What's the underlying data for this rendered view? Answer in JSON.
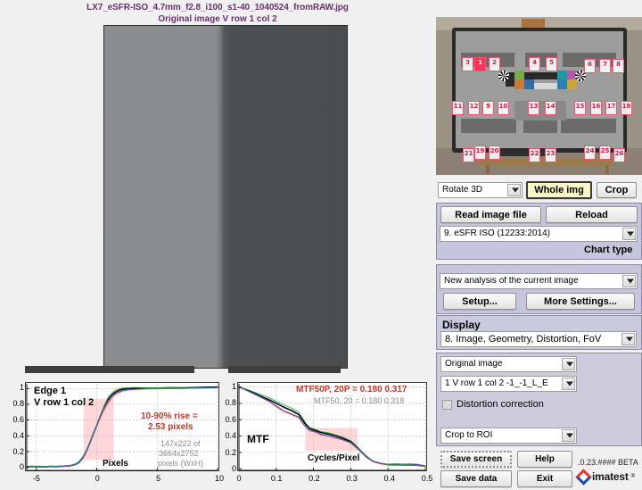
{
  "window": {
    "app": "Imatest",
    "version_text": ".0.23.#### BETA",
    "brand": "imatest",
    "brand_reg": "®"
  },
  "header": {
    "title_line1": "LX7_eSFR-ISO_4.7mm_f2.8_i100_s1-40_1040524_fromRAW.jpg",
    "title_line2": "Original image   V row 1 col 2",
    "title_color": "#6b2f6b"
  },
  "main_image": {
    "name": "edge-crop-preview",
    "description": "Original image V row 1 col 2 - vertical slanted edge crop",
    "left_luminance": "#8b8e90",
    "right_luminance": "#4a4d4f"
  },
  "thumbnail": {
    "name": "whole-image-thumbnail",
    "description": "eSFR ISO test chart on TV screen with 26 numbered edge ROIs",
    "roi_labels": [
      "1",
      "2",
      "3",
      "4",
      "5",
      "6",
      "7",
      "8",
      "9",
      "10",
      "11",
      "12",
      "13",
      "14",
      "15",
      "16",
      "17",
      "18",
      "19",
      "20",
      "21",
      "22",
      "23",
      "24",
      "25",
      "26"
    ],
    "selected_roi": "1",
    "roi_color": "#ff4d6d",
    "roi_selected_color": "#ff3355"
  },
  "controls": {
    "rotate_select": {
      "value": "Rotate 3D",
      "options": [
        "Rotate 3D"
      ]
    },
    "whole_img_button": "Whole img",
    "crop_button": "Crop",
    "read_image_file_button": "Read image file",
    "reload_button": "Reload",
    "chart_select": {
      "value": "9. eSFR ISO  (12233:2014)",
      "options": [
        "9. eSFR ISO  (12233:2014)"
      ]
    },
    "chart_type_label": "Chart type",
    "analysis_select": {
      "value": "New analysis of the current image",
      "options": [
        "New analysis of the current image"
      ]
    },
    "setup_button": "Setup...",
    "more_settings_button": "More Settings...",
    "display_label": "Display",
    "display_select": {
      "value": "8.   Image, Geometry, Distortion, FoV",
      "options": [
        "8.   Image, Geometry, Distortion, FoV"
      ]
    },
    "image_select": {
      "value": "Original image",
      "options": [
        "Original image"
      ]
    },
    "roi_select": {
      "value": "1  V row 1 col 2   -1_-1_L_E",
      "options": [
        "1  V row 1 col 2   -1_-1_L_E"
      ]
    },
    "distortion_correction": {
      "label": "Distortion correction",
      "checked": false
    },
    "crop_select": {
      "value": "Crop to ROI",
      "options": [
        "Crop to ROI"
      ]
    },
    "save_screen_button": "Save screen",
    "help_button": "Help",
    "save_data_button": "Save data",
    "exit_button": "Exit"
  },
  "chart_data": [
    {
      "type": "line",
      "name": "edge-profile-plot",
      "title": "Edge 1",
      "subtitle": "V row 1 col 2",
      "xlabel": "Pixels",
      "ylabel": "",
      "xlim": [
        -5.8,
        10
      ],
      "ylim": [
        -0.04,
        1.06
      ],
      "xticks": [
        -5,
        0,
        5,
        10
      ],
      "xticklabels": [
        "-5",
        "0",
        "5",
        "10"
      ],
      "yticks": [
        0,
        0.2,
        0.4,
        0.6,
        0.8,
        1
      ],
      "yticklabels": [
        "0",
        "0.2",
        "0.4",
        "0.6",
        "0.8",
        "1"
      ],
      "grid": true,
      "annotations": [
        {
          "text": "10-90% rise =",
          "color": "#c0392b",
          "bold": true
        },
        {
          "text": "2.53 pixels",
          "color": "#c0392b",
          "bold": true
        },
        {
          "text": "147x222 of",
          "color": "#8d8d8d",
          "bold": false
        },
        {
          "text": "3664x2752",
          "color": "#8d8d8d",
          "bold": false
        },
        {
          "text": "pixels (WxH)",
          "color": "#8d8d8d",
          "bold": false
        }
      ],
      "highlight_region": {
        "x0": -1.1,
        "x1": 1.4,
        "y0": 0.09,
        "y1": 0.87,
        "color": "#ffd0d4"
      },
      "series": [
        {
          "name": "Luminance",
          "color": "#000000",
          "x": [
            -5.8,
            -5.4,
            -5.0,
            -4.6,
            -4.2,
            -3.8,
            -3.4,
            -3.0,
            -2.6,
            -2.2,
            -1.8,
            -1.5,
            -1.2,
            -0.9,
            -0.6,
            -0.3,
            0.0,
            0.3,
            0.6,
            0.9,
            1.2,
            1.5,
            1.8,
            2.1,
            2.5,
            3.0,
            3.5,
            4.0,
            5.0,
            6.0,
            7.0,
            8.0,
            9.0,
            10.0
          ],
          "y": [
            0.005,
            0.012,
            0.008,
            0.01,
            0.007,
            0.012,
            0.009,
            0.013,
            0.016,
            0.02,
            0.035,
            0.06,
            0.11,
            0.19,
            0.3,
            0.42,
            0.53,
            0.65,
            0.76,
            0.85,
            0.91,
            0.95,
            0.975,
            0.99,
            0.995,
            1.0,
            1.0,
            1.0,
            1.005,
            1.01,
            1.008,
            1.012,
            1.015,
            1.018
          ]
        },
        {
          "name": "Red",
          "color": "#e8342b",
          "x": [
            -5.8,
            -5.4,
            -5.0,
            -4.6,
            -4.2,
            -3.8,
            -3.4,
            -3.0,
            -2.6,
            -2.2,
            -1.8,
            -1.5,
            -1.2,
            -0.9,
            -0.6,
            -0.3,
            0.0,
            0.3,
            0.6,
            0.9,
            1.2,
            1.5,
            1.8,
            2.1,
            2.5,
            3.0,
            3.5,
            4.0,
            5.0,
            6.0,
            7.0,
            8.0,
            9.0,
            10.0
          ],
          "y": [
            0.0,
            0.004,
            0.0,
            0.003,
            0.0,
            0.005,
            0.002,
            0.006,
            0.01,
            0.014,
            0.028,
            0.05,
            0.1,
            0.18,
            0.29,
            0.41,
            0.525,
            0.63,
            0.73,
            0.81,
            0.875,
            0.92,
            0.945,
            0.965,
            0.98,
            0.985,
            0.99,
            0.995,
            0.995,
            1.0,
            1.0,
            1.005,
            1.008,
            1.01
          ]
        },
        {
          "name": "Green",
          "color": "#21a33a",
          "x": [
            -5.8,
            -5.4,
            -5.0,
            -4.6,
            -4.2,
            -3.8,
            -3.4,
            -3.0,
            -2.6,
            -2.2,
            -1.8,
            -1.5,
            -1.2,
            -0.9,
            -0.6,
            -0.3,
            0.0,
            0.3,
            0.6,
            0.9,
            1.2,
            1.5,
            1.8,
            2.1,
            2.5,
            3.0,
            3.5,
            4.0,
            5.0,
            6.0,
            7.0,
            8.0,
            9.0,
            10.0
          ],
          "y": [
            0.008,
            0.015,
            0.01,
            0.013,
            0.01,
            0.015,
            0.012,
            0.016,
            0.02,
            0.026,
            0.042,
            0.07,
            0.125,
            0.205,
            0.315,
            0.435,
            0.545,
            0.665,
            0.78,
            0.875,
            0.935,
            0.975,
            0.995,
            1.005,
            1.01,
            1.012,
            1.012,
            1.01,
            1.008,
            1.008,
            1.006,
            1.008,
            1.01,
            1.012
          ]
        },
        {
          "name": "Blue",
          "color": "#5a5ad8",
          "x": [
            -5.8,
            -5.4,
            -5.0,
            -4.6,
            -4.2,
            -3.8,
            -3.4,
            -3.0,
            -2.6,
            -2.2,
            -1.8,
            -1.5,
            -1.2,
            -0.9,
            -0.6,
            -0.3,
            0.0,
            0.3,
            0.6,
            0.9,
            1.2,
            1.5,
            1.8,
            2.1,
            2.5,
            3.0,
            3.5,
            4.0,
            5.0,
            6.0,
            7.0,
            8.0,
            9.0,
            10.0
          ],
          "y": [
            0.002,
            0.007,
            0.003,
            0.006,
            0.002,
            0.008,
            0.004,
            0.009,
            0.012,
            0.017,
            0.031,
            0.055,
            0.105,
            0.185,
            0.295,
            0.415,
            0.53,
            0.645,
            0.75,
            0.835,
            0.895,
            0.935,
            0.96,
            0.975,
            0.985,
            0.99,
            0.993,
            0.996,
            0.998,
            1.0,
            1.0,
            1.002,
            1.005,
            1.008
          ]
        }
      ]
    },
    {
      "type": "line",
      "name": "mtf-plot",
      "title": "MTF",
      "xlabel": "Cycles/Pixel",
      "ylabel": "",
      "xlim": [
        0,
        0.5
      ],
      "ylim": [
        -0.02,
        1.04
      ],
      "xticks": [
        0,
        0.1,
        0.2,
        0.3,
        0.4,
        0.5
      ],
      "xticklabels": [
        "0",
        "0.1",
        "0.2",
        "0.3",
        "0.4",
        "0.5"
      ],
      "yticks": [
        0,
        0.2,
        0.4,
        0.6,
        0.8,
        1
      ],
      "yticklabels": [
        "0",
        "0.2",
        "0.4",
        "0.6",
        "0.8",
        "1"
      ],
      "grid": true,
      "annotations": [
        {
          "text": "MTF50P, 20P = 0.180  0.317",
          "color": "#c0392b",
          "bold": true
        },
        {
          "text": "MTF50, 20  =  0.180  0.318",
          "color": "#8d8d8d",
          "bold": false
        }
      ],
      "highlight_region": {
        "x0": 0.178,
        "x1": 0.318,
        "y0": 0.22,
        "y1": 0.5,
        "color": "#ffd0d4"
      },
      "mtf50p": 0.18,
      "mtf20p": 0.317,
      "mtf50": 0.18,
      "mtf20": 0.318,
      "series": [
        {
          "name": "Luminance",
          "color": "#000000",
          "x": [
            0,
            0.02,
            0.04,
            0.06,
            0.08,
            0.1,
            0.12,
            0.14,
            0.16,
            0.18,
            0.19,
            0.2,
            0.21,
            0.22,
            0.24,
            0.26,
            0.28,
            0.3,
            0.32,
            0.34,
            0.36,
            0.38,
            0.4,
            0.42,
            0.44,
            0.46,
            0.48,
            0.5
          ],
          "y": [
            1.0,
            0.965,
            0.925,
            0.885,
            0.845,
            0.8,
            0.755,
            0.715,
            0.665,
            0.535,
            0.49,
            0.475,
            0.46,
            0.445,
            0.425,
            0.4,
            0.37,
            0.33,
            0.25,
            0.155,
            0.09,
            0.065,
            0.05,
            0.048,
            0.046,
            0.045,
            0.042,
            0.03
          ]
        },
        {
          "name": "Red",
          "color": "#e8342b",
          "x": [
            0,
            0.02,
            0.04,
            0.06,
            0.08,
            0.1,
            0.12,
            0.14,
            0.16,
            0.18,
            0.19,
            0.2,
            0.21,
            0.22,
            0.24,
            0.26,
            0.28,
            0.3,
            0.32,
            0.34,
            0.36,
            0.38,
            0.4,
            0.42,
            0.44,
            0.46,
            0.48,
            0.5
          ],
          "y": [
            1.0,
            0.96,
            0.915,
            0.87,
            0.825,
            0.76,
            0.7,
            0.665,
            0.625,
            0.5,
            0.465,
            0.455,
            0.44,
            0.415,
            0.4,
            0.375,
            0.35,
            0.315,
            0.235,
            0.145,
            0.085,
            0.06,
            0.048,
            0.046,
            0.045,
            0.044,
            0.04,
            0.028
          ]
        },
        {
          "name": "Green",
          "color": "#21a33a",
          "x": [
            0,
            0.02,
            0.04,
            0.06,
            0.08,
            0.1,
            0.12,
            0.14,
            0.16,
            0.18,
            0.19,
            0.2,
            0.21,
            0.22,
            0.24,
            0.26,
            0.28,
            0.3,
            0.32,
            0.34,
            0.36,
            0.38,
            0.4,
            0.42,
            0.44,
            0.46,
            0.48,
            0.5
          ],
          "y": [
            1.0,
            0.975,
            0.94,
            0.905,
            0.87,
            0.825,
            0.785,
            0.745,
            0.695,
            0.555,
            0.505,
            0.49,
            0.475,
            0.455,
            0.44,
            0.415,
            0.385,
            0.345,
            0.26,
            0.165,
            0.095,
            0.068,
            0.052,
            0.05,
            0.048,
            0.046,
            0.043,
            0.032
          ]
        },
        {
          "name": "Blue",
          "color": "#5a5ad8",
          "x": [
            0,
            0.02,
            0.04,
            0.06,
            0.08,
            0.1,
            0.12,
            0.14,
            0.16,
            0.18,
            0.19,
            0.2,
            0.21,
            0.22,
            0.24,
            0.26,
            0.28,
            0.3,
            0.32,
            0.34,
            0.36,
            0.38,
            0.4,
            0.42,
            0.44,
            0.46,
            0.48,
            0.5
          ],
          "y": [
            1.0,
            0.958,
            0.918,
            0.875,
            0.83,
            0.77,
            0.715,
            0.675,
            0.635,
            0.505,
            0.47,
            0.46,
            0.445,
            0.425,
            0.405,
            0.38,
            0.355,
            0.32,
            0.245,
            0.15,
            0.09,
            0.068,
            0.058,
            0.062,
            0.058,
            0.06,
            0.055,
            0.038
          ]
        }
      ]
    }
  ]
}
